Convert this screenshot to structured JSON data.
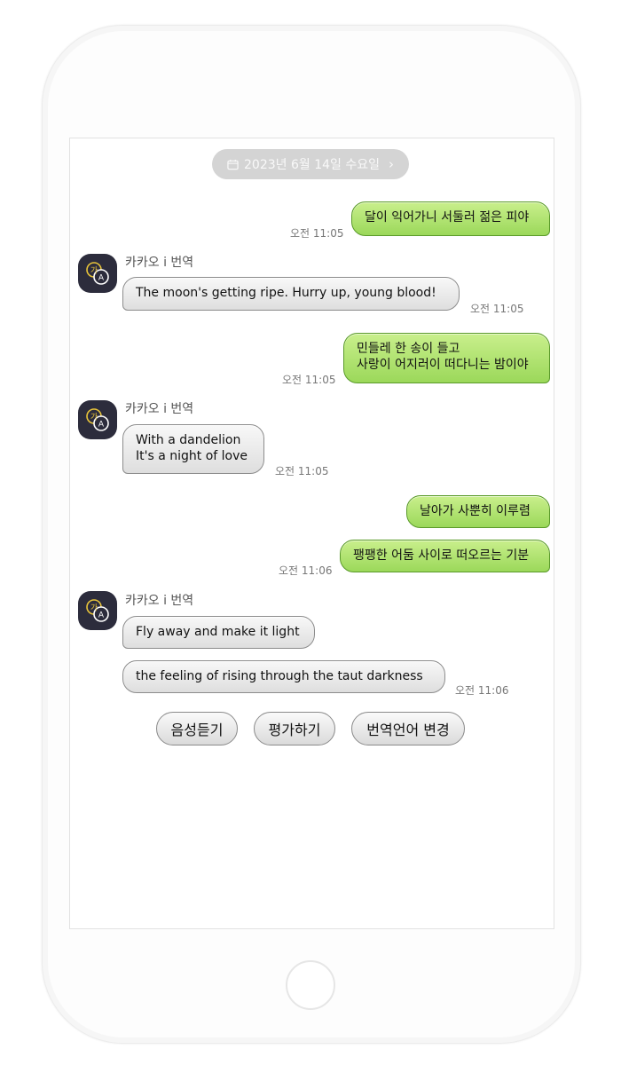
{
  "date_header": {
    "label": "2023년 6월 14일 수요일",
    "chevron": "›",
    "icon": "calendar-icon"
  },
  "bot": {
    "name": "카카오 i 번역",
    "avatar_icon": "translate-icon",
    "avatar_glyph_top": "가",
    "avatar_glyph_bottom": "A"
  },
  "messages": [
    {
      "from": "me",
      "text": "달이 익어가니 서둘러 젊은 피야",
      "time": "오전 11:05"
    },
    {
      "from": "bot",
      "text": "The moon's getting ripe. Hurry up, young blood!",
      "time": "오전 11:05"
    },
    {
      "from": "me",
      "lines": [
        "민들레 한 송이 들고",
        "사랑이 어지러이 떠다니는 밤이야"
      ],
      "time": "오전 11:05"
    },
    {
      "from": "bot",
      "lines": [
        "With a dandelion",
        "It's a night of love"
      ],
      "time": "오전 11:05"
    },
    {
      "from": "me",
      "text": "날아가 사뿐히 이루렴"
    },
    {
      "from": "me",
      "text": "팽팽한 어둠 사이로 떠오르는 기분",
      "time": "오전 11:06"
    },
    {
      "from": "bot",
      "text": "Fly away and make it light"
    },
    {
      "from": "bot",
      "text": "the feeling of rising through the taut darkness",
      "time": "오전 11:06"
    }
  ],
  "actions": {
    "listen": "음성듣기",
    "rate": "평가하기",
    "change_language": "번역언어 변경"
  },
  "colors": {
    "my_bubble": "#b5e473",
    "bot_bubble": "#e6e6e6",
    "date_pill": "#d4d4d4",
    "avatar_bg": "#2c2c3c",
    "avatar_ring": "#e8c43a"
  }
}
